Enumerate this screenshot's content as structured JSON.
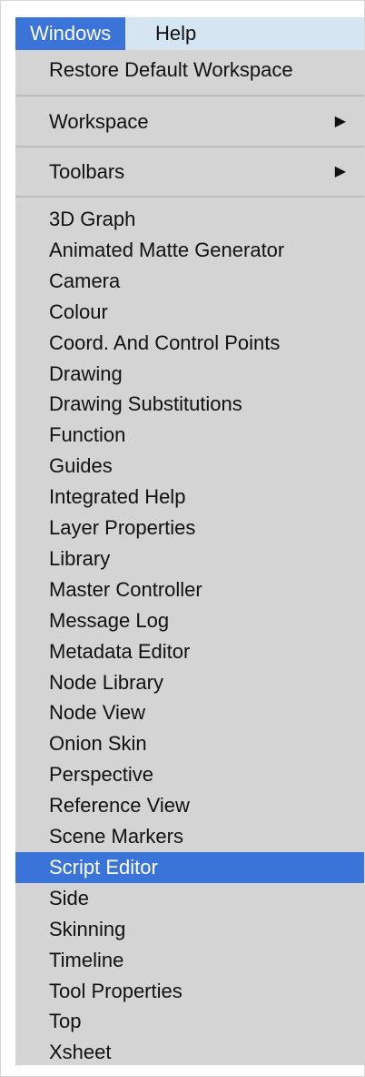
{
  "menubar": {
    "items": [
      {
        "label": "Windows",
        "active": true
      },
      {
        "label": "Help",
        "active": false
      }
    ]
  },
  "menu": {
    "top_items": [
      {
        "label": "Restore Default Workspace"
      }
    ],
    "submenus": [
      {
        "label": "Workspace",
        "arrow": "▶"
      },
      {
        "label": "Toolbars",
        "arrow": "▶"
      }
    ],
    "windows": [
      "3D Graph",
      "Animated Matte Generator",
      "Camera",
      "Colour",
      "Coord. And Control Points",
      "Drawing",
      "Drawing Substitutions",
      "Function",
      "Guides",
      "Integrated Help",
      "Layer Properties",
      "Library",
      "Master Controller",
      "Message Log",
      "Metadata Editor",
      "Node Library",
      "Node View",
      "Onion Skin",
      "Perspective",
      "Reference View",
      "Scene Markers",
      "Script Editor",
      "Side",
      "Skinning",
      "Timeline",
      "Tool Properties",
      "Top",
      "Xsheet"
    ],
    "highlighted": "Script Editor"
  },
  "colors": {
    "accent": "#3b74d8",
    "menubar_bg": "#d5e5f2",
    "menu_bg": "#d4d4d4"
  }
}
